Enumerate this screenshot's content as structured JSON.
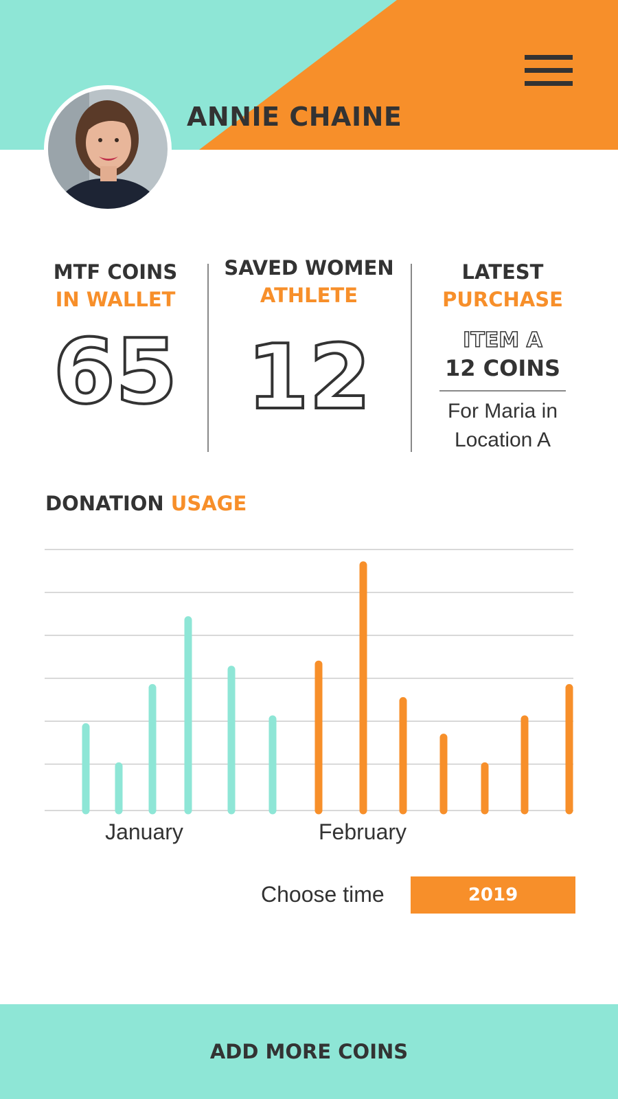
{
  "profile": {
    "name": "ANNIE CHAINE"
  },
  "stats": {
    "coins": {
      "title": "MTF COINS",
      "subtitle": "IN WALLET",
      "value": "65"
    },
    "saved": {
      "title": "SAVED WOMEN",
      "subtitle": "ATHLETE",
      "value": "12"
    },
    "latest": {
      "title": "LATEST",
      "subtitle": "PURCHASE",
      "item": "ITEM A",
      "cost": "12 COINS",
      "desc_line1": "For Maria in",
      "desc_line2": "Location A"
    }
  },
  "donation": {
    "title_main": "DONATION",
    "title_accent": "USAGE"
  },
  "chart_data": {
    "type": "bar",
    "categories": [
      "January",
      "February"
    ],
    "series": [
      {
        "values": [
          0.32,
          0.17,
          0.47,
          0.73,
          0.54,
          0.35
        ]
      },
      {
        "values": [
          0.56,
          0.94,
          0.42,
          0.28,
          0.17,
          0.35,
          0.47
        ]
      }
    ],
    "ylim": [
      0,
      1
    ],
    "grid": true,
    "xlabel": "",
    "ylabel": ""
  },
  "controls": {
    "choose_label": "Choose time",
    "year": "2019"
  },
  "footer": {
    "cta_label": "ADD MORE COINS"
  },
  "colors": {
    "teal": "#8ee6d6",
    "orange": "#f78f2a",
    "dark": "#333333",
    "grid": "#cccccc"
  },
  "icons": {
    "menu": "hamburger-menu-icon"
  }
}
